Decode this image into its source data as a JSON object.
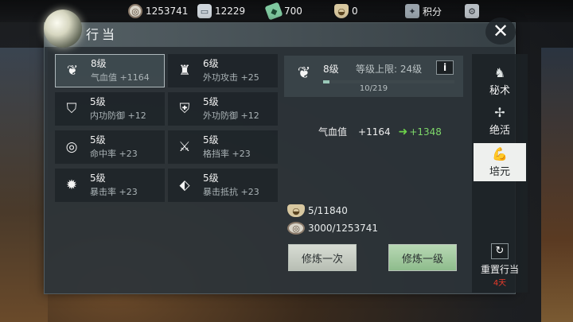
{
  "topbar": {
    "coins": "1253741",
    "silver": "12229",
    "jade": "700",
    "ingot": "0",
    "score_label": "积分"
  },
  "panel": {
    "title": "行当"
  },
  "stats": [
    {
      "level": "8级",
      "stat": "气血值 +1164",
      "icon": "heart-lotus-icon"
    },
    {
      "level": "6级",
      "stat": "外功攻击 +25",
      "icon": "sword-tower-icon"
    },
    {
      "level": "5级",
      "stat": "内功防御 +12",
      "icon": "shield-icon"
    },
    {
      "level": "5级",
      "stat": "外功防御 +12",
      "icon": "armor-icon"
    },
    {
      "level": "5级",
      "stat": "命中率 +23",
      "icon": "target-icon"
    },
    {
      "level": "5级",
      "stat": "格挡率 +23",
      "icon": "crossed-swords-icon"
    },
    {
      "level": "5级",
      "stat": "暴击率 +23",
      "icon": "burst-icon"
    },
    {
      "level": "5级",
      "stat": "暴击抵抗 +23",
      "icon": "broken-shield-icon"
    }
  ],
  "detail": {
    "level": "8级",
    "cap": "等级上限: 24级",
    "info": "i",
    "progress_text": "10/219",
    "progress_current": 10,
    "progress_max": 219,
    "stat_name": "气血值",
    "stat_current": "+1164",
    "stat_next": "+1348",
    "cost_ingot": "5/11840",
    "cost_coins": "3000/1253741",
    "btn_once": "修炼一次",
    "btn_level": "修炼一级"
  },
  "tabs": [
    {
      "label": "秘术",
      "icon": "scroll-icon"
    },
    {
      "label": "绝活",
      "icon": "crossbow-icon"
    },
    {
      "label": "培元",
      "icon": "muscle-icon"
    }
  ],
  "reset": {
    "label": "重置行当",
    "days": "4天"
  }
}
